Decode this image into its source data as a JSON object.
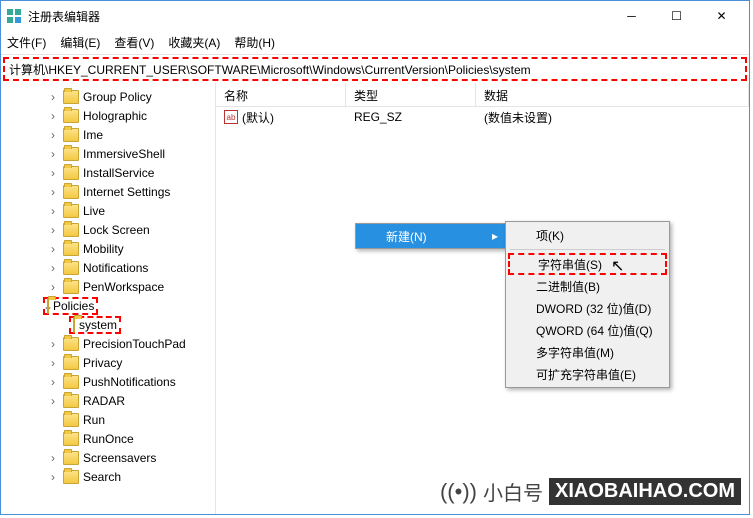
{
  "window": {
    "title": "注册表编辑器"
  },
  "menu": {
    "file": "文件(F)",
    "edit": "编辑(E)",
    "view": "查看(V)",
    "favorites": "收藏夹(A)",
    "help": "帮助(H)"
  },
  "address": "计算机\\HKEY_CURRENT_USER\\SOFTWARE\\Microsoft\\Windows\\CurrentVersion\\Policies\\system",
  "tree": {
    "items": [
      "Group Policy",
      "Holographic",
      "Ime",
      "ImmersiveShell",
      "InstallService",
      "Internet Settings",
      "Live",
      "Lock Screen",
      "Mobility",
      "Notifications",
      "PenWorkspace",
      "Policies",
      "system",
      "PrecisionTouchPad",
      "Privacy",
      "PushNotifications",
      "RADAR",
      "Run",
      "RunOnce",
      "Screensavers",
      "Search"
    ]
  },
  "details": {
    "headers": {
      "name": "名称",
      "type": "类型",
      "data": "数据"
    },
    "row": {
      "icon": "ab",
      "name": "(默认)",
      "type": "REG_SZ",
      "data": "(数值未设置)"
    }
  },
  "ctx1": {
    "new": "新建(N)"
  },
  "ctx2": {
    "key": "项(K)",
    "string": "字符串值(S)",
    "binary": "二进制值(B)",
    "dword": "DWORD (32 位)值(D)",
    "qword": "QWORD (64 位)值(Q)",
    "multi": "多字符串值(M)",
    "expand": "可扩充字符串值(E)"
  },
  "watermark": "@小白号",
  "brand": {
    "t1": "小白号",
    "t2": "XIAOBAIHAO.COM"
  }
}
